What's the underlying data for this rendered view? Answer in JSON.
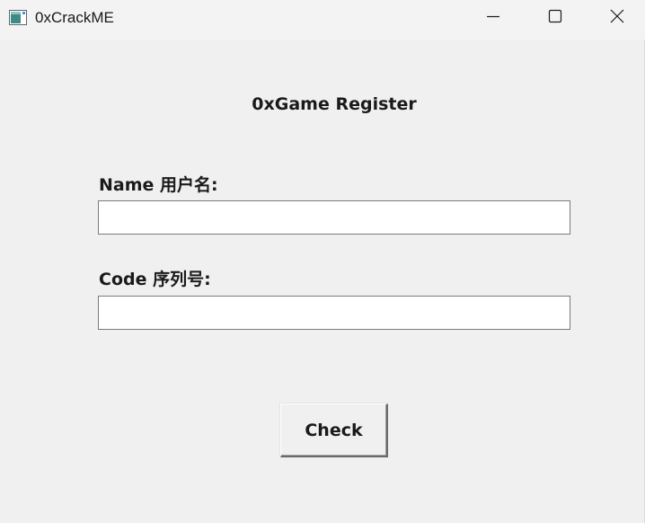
{
  "window": {
    "title": "0xCrackME",
    "controls": {
      "minimize": "minimize-icon",
      "maximize": "maximize-icon",
      "close": "close-icon"
    },
    "app_icon": "window-app-icon"
  },
  "form": {
    "heading": "0xGame Register",
    "name_label": "Name 用户名:",
    "name_value": "",
    "code_label": "Code 序列号:",
    "code_value": "",
    "check_label": "Check"
  },
  "colors": {
    "background": "#f0f0f0",
    "field_border": "#7a7a7a",
    "field_background": "#ffffff",
    "text": "#1a1a1a"
  }
}
